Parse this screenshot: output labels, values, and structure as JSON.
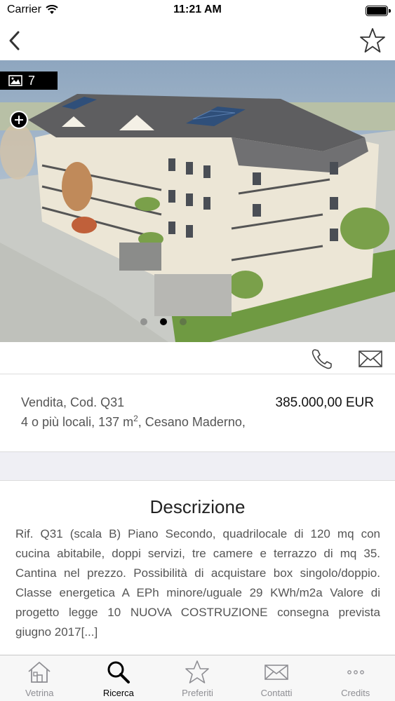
{
  "status_bar": {
    "carrier": "Carrier",
    "time": "11:21 AM"
  },
  "nav": {
    "back_icon": "chevron-left-icon",
    "favorite_icon": "star-outline-icon"
  },
  "gallery": {
    "photo_count": "7",
    "dots": 3,
    "active_dot": 2
  },
  "actions": {
    "phone_icon": "phone-icon",
    "mail_icon": "envelope-icon"
  },
  "listing": {
    "sale_code": "Vendita, Cod. Q31",
    "price": "385.000,00 EUR",
    "details_prefix": "4 o più locali, 137 m",
    "details_sup": "2",
    "details_suffix": ", Cesano Maderno,"
  },
  "description": {
    "title": "Descrizione",
    "text": "Rif. Q31 (scala B) Piano Secondo, quadrilocale di 120 mq con cucina abitabile, doppi servizi, tre camere e terrazzo di mq 35. Cantina nel prezzo. Possibilità di acquistare box singolo/doppio. Classe energetica A EPh minore/uguale 29 KWh/m2a Valore di progetto legge 10 NUOVA COSTRUZIONE consegna prevista giugno 2017[...]"
  },
  "tabs": [
    {
      "label": "Vetrina",
      "icon": "house-icon",
      "active": false
    },
    {
      "label": "Ricerca",
      "icon": "search-icon",
      "active": true
    },
    {
      "label": "Preferiti",
      "icon": "star-icon",
      "active": false
    },
    {
      "label": "Contatti",
      "icon": "envelope-icon",
      "active": false
    },
    {
      "label": "Credits",
      "icon": "more-icon",
      "active": false
    }
  ],
  "colors": {
    "accent": "#000000",
    "tab_inactive": "#8e8e93",
    "band": "#efeff4"
  }
}
